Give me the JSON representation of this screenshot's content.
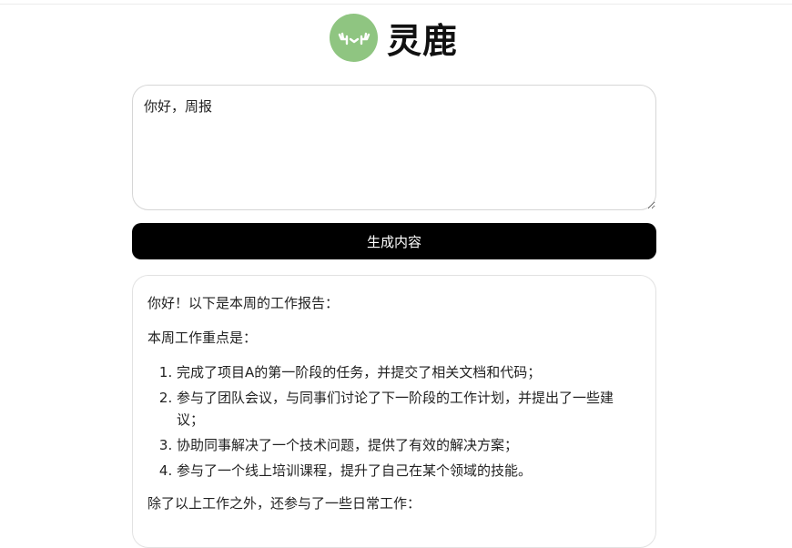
{
  "brand": {
    "name": "灵鹿",
    "logo_color": "#8fc581"
  },
  "prompt": {
    "value": "你好，周报"
  },
  "actions": {
    "generate_label": "生成内容"
  },
  "result": {
    "greeting": "你好！以下是本周的工作报告：",
    "focus_heading": "本周工作重点是：",
    "items": [
      "完成了项目A的第一阶段的任务，并提交了相关文档和代码；",
      "参与了团队会议，与同事们讨论了下一阶段的工作计划，并提出了一些建议；",
      "协助同事解决了一个技术问题，提供了有效的解决方案；",
      "参与了一个线上培训课程，提升了自己在某个领域的技能。"
    ],
    "extra_heading": "除了以上工作之外，还参与了一些日常工作："
  }
}
